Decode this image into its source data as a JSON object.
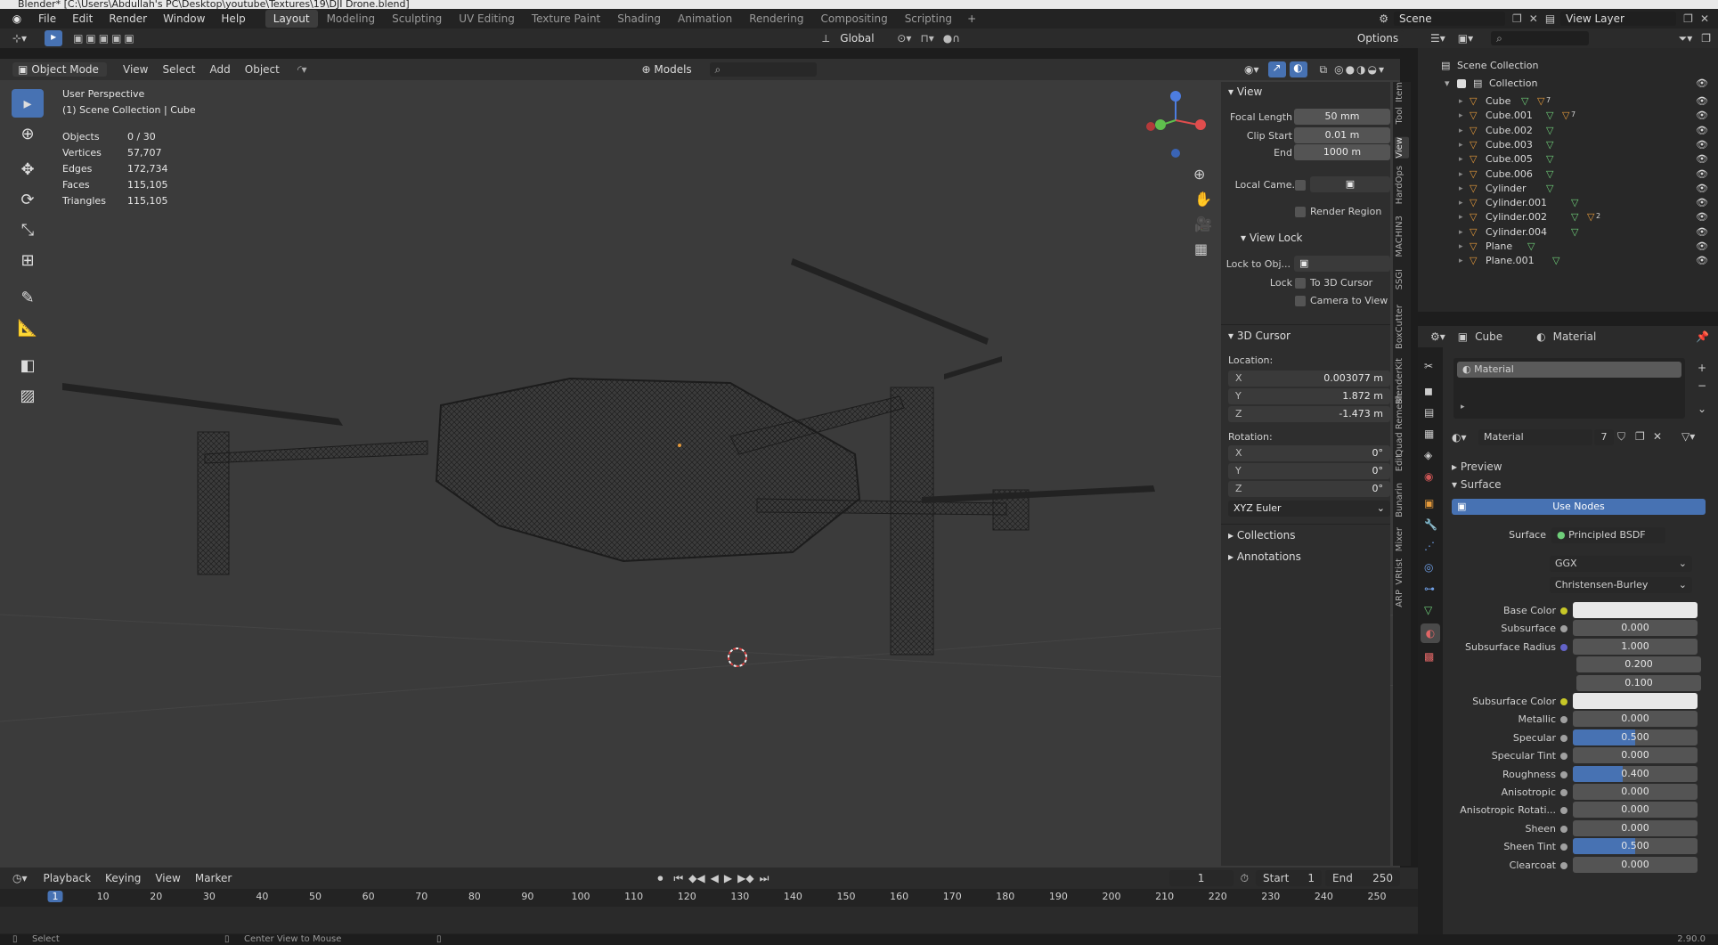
{
  "window_title": "Blender* [C:\\Users\\Abdullah's PC\\Desktop\\youtube\\Textures\\19\\DJI Drone.blend]",
  "menus": [
    "File",
    "Edit",
    "Render",
    "Window",
    "Help"
  ],
  "workspaces": [
    "Layout",
    "Modeling",
    "Sculpting",
    "UV Editing",
    "Texture Paint",
    "Shading",
    "Animation",
    "Rendering",
    "Compositing",
    "Scripting"
  ],
  "add_workspace": "+",
  "scene": "Scene",
  "view_layer": "View Layer",
  "toolbar": {
    "orientation": "Global",
    "options": "Options"
  },
  "viewport_header": {
    "mode": "Object Mode",
    "menus": [
      "View",
      "Select",
      "Add",
      "Object"
    ],
    "models": "Models"
  },
  "overlay_info": {
    "perspective": "User Perspective",
    "collection": "(1) Scene Collection | Cube",
    "stats": [
      {
        "label": "Objects",
        "value": "0 / 30"
      },
      {
        "label": "Vertices",
        "value": "57,707"
      },
      {
        "label": "Edges",
        "value": "172,734"
      },
      {
        "label": "Faces",
        "value": "115,105"
      },
      {
        "label": "Triangles",
        "value": "115,105"
      }
    ]
  },
  "npanel": {
    "view_title": "View",
    "focal_length_label": "Focal Length",
    "focal_length": "50 mm",
    "clip_start_label": "Clip Start",
    "clip_start": "0.01 m",
    "end_label": "End",
    "end": "1000 m",
    "local_camera_label": "Local Came...",
    "render_region": "Render Region",
    "view_lock_title": "View Lock",
    "lock_to_obj_label": "Lock to Obj...",
    "lock_label": "Lock",
    "to_3d_cursor": "To 3D Cursor",
    "camera_to_view": "Camera to View",
    "cursor_title": "3D Cursor",
    "location_label": "Location:",
    "loc": [
      {
        "axis": "X",
        "value": "0.003077 m"
      },
      {
        "axis": "Y",
        "value": "1.872 m"
      },
      {
        "axis": "Z",
        "value": "-1.473 m"
      }
    ],
    "rotation_label": "Rotation:",
    "rot": [
      {
        "axis": "X",
        "value": "0°"
      },
      {
        "axis": "Y",
        "value": "0°"
      },
      {
        "axis": "Z",
        "value": "0°"
      }
    ],
    "rotation_mode": "XYZ Euler",
    "collections": "Collections",
    "annotations": "Annotations"
  },
  "side_tabs": [
    "Item",
    "Tool",
    "View",
    "HardOps",
    "MACHIN3",
    "SSGI",
    "BoxCutter",
    "BlenderKit",
    "Quad Remesh",
    "Edit",
    "Bunarin",
    "Mixer",
    "VRtist",
    "ARP"
  ],
  "outliner": {
    "scene_collection": "Scene Collection",
    "collection": "Collection",
    "items": [
      {
        "name": "Cube",
        "badge": "7"
      },
      {
        "name": "Cube.001",
        "badge": "7"
      },
      {
        "name": "Cube.002",
        "badge": ""
      },
      {
        "name": "Cube.003",
        "badge": ""
      },
      {
        "name": "Cube.005",
        "badge": ""
      },
      {
        "name": "Cube.006",
        "badge": ""
      },
      {
        "name": "Cylinder",
        "badge": ""
      },
      {
        "name": "Cylinder.001",
        "badge": ""
      },
      {
        "name": "Cylinder.002",
        "badge": "2"
      },
      {
        "name": "Cylinder.004",
        "badge": ""
      },
      {
        "name": "Plane",
        "badge": ""
      },
      {
        "name": "Plane.001",
        "badge": ""
      }
    ]
  },
  "properties": {
    "object": "Cube",
    "material_tab": "Material",
    "slot": "Material",
    "material_name": "Material",
    "users": "7",
    "preview": "Preview",
    "surface_title": "Surface",
    "use_nodes": "Use Nodes",
    "surface_label": "Surface",
    "surface_shader": "Principled BSDF",
    "distribution": "GGX",
    "sss_method": "Christensen-Burley",
    "params": [
      {
        "label": "Base Color",
        "value": "",
        "kind": "color",
        "fill": 0
      },
      {
        "label": "Subsurface",
        "value": "0.000",
        "kind": "num",
        "fill": 0
      },
      {
        "label": "Subsurface Radius",
        "value": "1.000",
        "kind": "num",
        "fill": 0
      },
      {
        "label": "",
        "value": "0.200",
        "kind": "num",
        "fill": 0
      },
      {
        "label": "",
        "value": "0.100",
        "kind": "num",
        "fill": 0
      },
      {
        "label": "Subsurface Color",
        "value": "",
        "kind": "color",
        "fill": 0
      },
      {
        "label": "Metallic",
        "value": "0.000",
        "kind": "num",
        "fill": 0
      },
      {
        "label": "Specular",
        "value": "0.500",
        "kind": "num",
        "fill": 0.5
      },
      {
        "label": "Specular Tint",
        "value": "0.000",
        "kind": "num",
        "fill": 0
      },
      {
        "label": "Roughness",
        "value": "0.400",
        "kind": "num",
        "fill": 0.4
      },
      {
        "label": "Anisotropic",
        "value": "0.000",
        "kind": "num",
        "fill": 0
      },
      {
        "label": "Anisotropic Rotati...",
        "value": "0.000",
        "kind": "num",
        "fill": 0
      },
      {
        "label": "Sheen",
        "value": "0.000",
        "kind": "num",
        "fill": 0
      },
      {
        "label": "Sheen Tint",
        "value": "0.500",
        "kind": "num",
        "fill": 0.5
      },
      {
        "label": "Clearcoat",
        "value": "0.000",
        "kind": "num",
        "fill": 0
      }
    ]
  },
  "timeline": {
    "menus": [
      "Playback",
      "Keying",
      "View",
      "Marker"
    ],
    "current_frame": "1",
    "start_label": "Start",
    "start": "1",
    "end_label": "End",
    "end": "250",
    "ticks": [
      "1",
      "10",
      "20",
      "30",
      "40",
      "50",
      "60",
      "70",
      "80",
      "90",
      "100",
      "110",
      "120",
      "130",
      "140",
      "150",
      "160",
      "170",
      "180",
      "190",
      "200",
      "210",
      "220",
      "230",
      "240",
      "250"
    ]
  },
  "status_bar": {
    "left": "Select",
    "middle": "Center View to Mouse",
    "version": "2.90.0"
  },
  "colors": {
    "accent": "#4772b3",
    "mesh_orange": "#e59a3b",
    "mesh_green": "#6fcf7a",
    "bg_viewport": "#3b3b3b"
  }
}
